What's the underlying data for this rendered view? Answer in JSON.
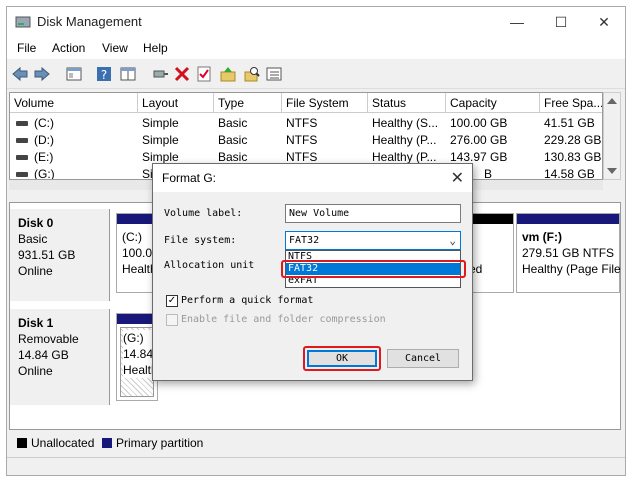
{
  "window": {
    "title": "Disk Management"
  },
  "menu": [
    "File",
    "Action",
    "View",
    "Help"
  ],
  "volume_list": {
    "columns": [
      "Volume",
      "Layout",
      "Type",
      "File System",
      "Status",
      "Capacity",
      "Free Spa..."
    ],
    "rows": [
      [
        "(C:)",
        "Simple",
        "Basic",
        "NTFS",
        "Healthy (S...",
        "100.00 GB",
        "41.51 GB"
      ],
      [
        "(D:)",
        "Simple",
        "Basic",
        "NTFS",
        "Healthy (P...",
        "276.00 GB",
        "229.28 GB"
      ],
      [
        "(E:)",
        "Simple",
        "Basic",
        "NTFS",
        "Healthy (P...",
        "143.97 GB",
        "130.83 GB"
      ],
      [
        "(G:)",
        "Si",
        "",
        "",
        "",
        "B",
        "14.58 GB"
      ]
    ]
  },
  "disks": [
    {
      "name": "Disk 0",
      "type": "Basic",
      "size": "931.51 GB",
      "status": "Online"
    },
    {
      "name": "Disk 1",
      "type": "Removable",
      "size": "14.84 GB",
      "status": "Online"
    }
  ],
  "partitions": {
    "c": {
      "name": "(C:)",
      "line2": "100.00",
      "line3": "Health"
    },
    "hidden": {
      "line3": "ed"
    },
    "f": {
      "name": "vm  (F:)",
      "line2": "279.51 GB NTFS",
      "line3": "Healthy (Page File"
    },
    "g": {
      "name": "(G:)",
      "line2": "14.84",
      "line3": "Health"
    }
  },
  "legend": {
    "unallocated": "Unallocated",
    "primary": "Primary partition"
  },
  "dialog": {
    "title": "Format G:",
    "volume_label_label": "Volume label:",
    "volume_label_value": "New Volume",
    "file_system_label": "File system:",
    "file_system_value": "FAT32",
    "fs_options": [
      "NTFS",
      "FAT32",
      "exFAT"
    ],
    "allocation_label": "Allocation unit",
    "quick_format_label": "Perform a quick format",
    "quick_format_checked": "✓",
    "compression_label": "Enable file and folder compression",
    "ok_label": "OK",
    "cancel_label": "Cancel"
  },
  "colors": {
    "primary": "#18187a",
    "unallocated": "#000000",
    "highlight": "#e0191e",
    "selection": "#0078d7"
  }
}
